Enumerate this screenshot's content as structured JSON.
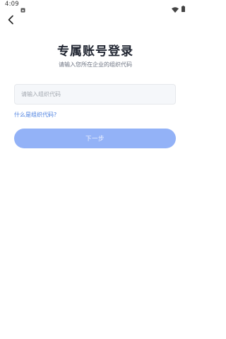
{
  "status_bar": {
    "time": "4:09",
    "icons": [
      "notification-icon",
      "wifi-icon",
      "battery-icon"
    ]
  },
  "header": {
    "back_icon": "chevron-left-icon",
    "title": "专属账号登录",
    "subtitle": "请输入您所在企业的组织代码"
  },
  "form": {
    "org_code_value": "",
    "org_code_placeholder": "请输入组织代码",
    "help_link": "什么是组织代码?",
    "next_label": "下一步"
  },
  "colors": {
    "accent": "#4a7fe0",
    "button_disabled_bg": "#93b2f7",
    "input_bg": "#f5f7fa",
    "title": "#1f2430",
    "subtitle": "#6b7280"
  }
}
